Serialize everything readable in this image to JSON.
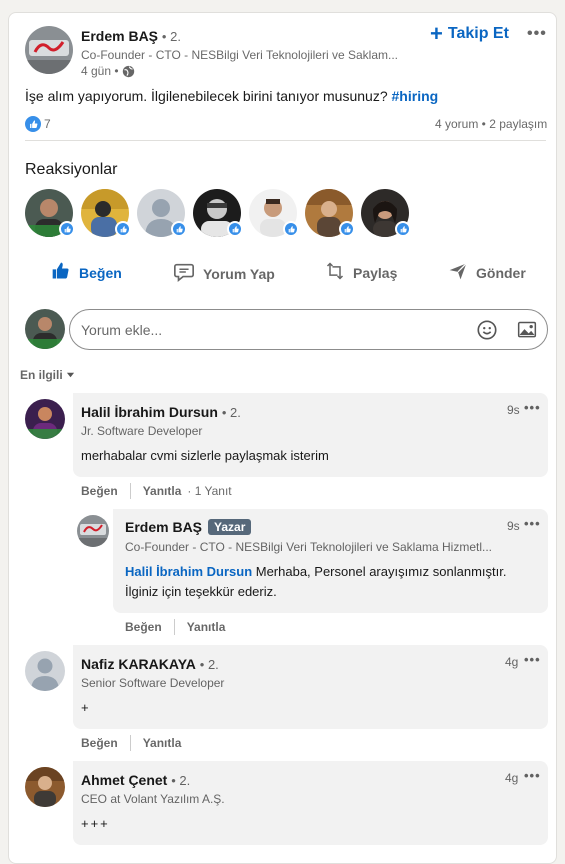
{
  "post": {
    "author": {
      "name": "Erdem BAŞ",
      "degree": "• 2.",
      "headline": "Co-Founder - CTO - NESBilgi Veri Teknolojileri ve Saklam...",
      "time": "4 gün •"
    },
    "follow_label": "Takip Et",
    "more_label": "•••",
    "text": "İşe alım yapıyorum. İlgilenebilecek birini tanıyor musunuz?",
    "hashtag": "#hiring",
    "reaction_count": "7",
    "stats": "4 yorum • 2 paylaşım"
  },
  "reactions": {
    "title": "Reaksiyonlar",
    "avatars": [
      "reactor-1",
      "reactor-2",
      "reactor-3",
      "reactor-4",
      "reactor-5",
      "reactor-6",
      "reactor-7"
    ]
  },
  "actions": {
    "like": "Beğen",
    "comment": "Yorum Yap",
    "share": "Paylaş",
    "send": "Gönder"
  },
  "comment_input": {
    "placeholder": "Yorum ekle..."
  },
  "sort": {
    "label": "En ilgili"
  },
  "comments": [
    {
      "name": "Halil İbrahim Dursun",
      "degree": "• 2.",
      "headline": "Jr. Software Developer",
      "time": "9s",
      "text": "merhabalar cvmi sizlerle paylaşmak isterim",
      "like": "Beğen",
      "reply": "Yanıtla",
      "reply_count": "· 1 Yanıt"
    },
    {
      "name": "Erdem BAŞ",
      "badge": "Yazar",
      "headline": "Co-Founder - CTO - NESBilgi Veri Teknolojileri ve Saklama Hizmetl...",
      "time": "9s",
      "mention": "Halil İbrahim Dursun",
      "text_line1": " Merhaba, Personel arayışımız sonlanmıştır.",
      "text_line2": "İlginiz için teşekkür ederiz.",
      "like": "Beğen",
      "reply": "Yanıtla"
    },
    {
      "name": "Nafiz KARAKAYA",
      "degree": "• 2.",
      "headline": "Senior Software Developer",
      "time": "4g",
      "text": "+",
      "like": "Beğen",
      "reply": "Yanıtla"
    },
    {
      "name": "Ahmet Çenet",
      "degree": "• 2.",
      "headline": "CEO at Volant Yazılım A.Ş.",
      "time": "4g",
      "text": "+++"
    }
  ],
  "colors": {
    "accent": "#0a66c2",
    "like_blue": "#378fe9",
    "bubble": "#f2f2f2",
    "author_badge": "#56687a"
  }
}
